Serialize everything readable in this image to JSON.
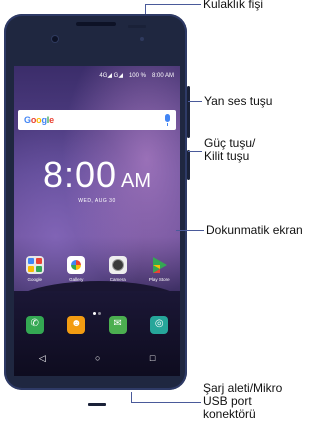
{
  "status_bar": {
    "signal": "4G◢ G◢",
    "battery": "100 %",
    "time": "8:00 AM"
  },
  "search": {
    "logo_parts": [
      "G",
      "o",
      "o",
      "g",
      "l",
      "e"
    ]
  },
  "clock": {
    "time": "8:00",
    "ampm": "AM",
    "date": "WED, AUG 30"
  },
  "apps": [
    {
      "label": "Google"
    },
    {
      "label": "Gallery"
    },
    {
      "label": "Camera"
    },
    {
      "label": "Play Store"
    }
  ],
  "dock": {
    "icons": [
      "phone-icon",
      "contacts-icon",
      "messages-icon",
      "browser-icon"
    ],
    "glyphs": [
      "✆",
      "☻",
      "✉",
      "◎"
    ]
  },
  "navbar": {
    "back": "◁",
    "home": "○",
    "recents": "□"
  },
  "callouts": {
    "headphone_jack": "Kulaklık fişi",
    "volume_button": "Yan ses tuşu",
    "power_button_line1": "Güç tuşu/",
    "power_button_line2": "Kilit tuşu",
    "touchscreen": "Dokunmatik ekran",
    "usb_line1": "Şarj aleti/Mikro",
    "usb_line2": "USB port",
    "usb_line3": "konektörü"
  },
  "colors": {
    "phone_body": "#1f2740",
    "leader_line": "#4a5a9a"
  }
}
